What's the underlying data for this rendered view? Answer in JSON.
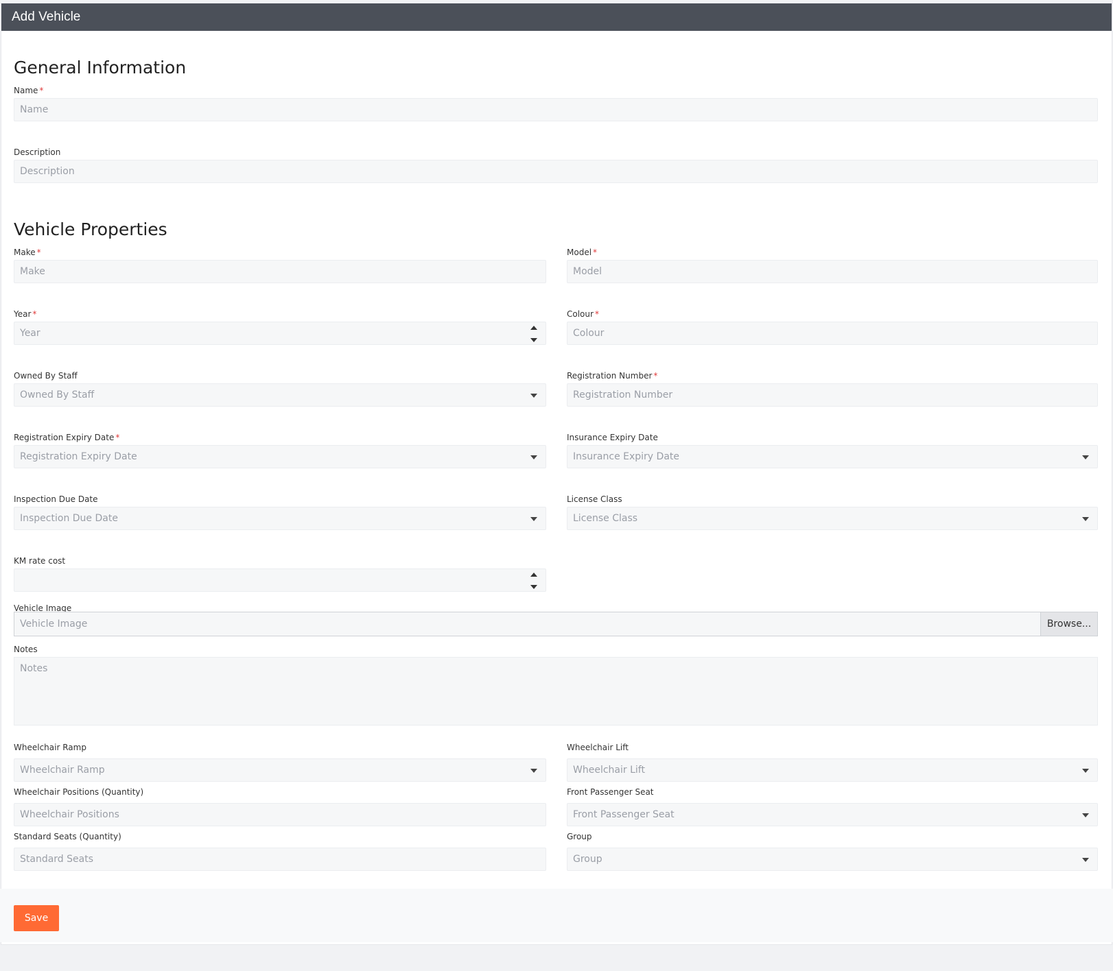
{
  "header": {
    "title": "Add Vehicle"
  },
  "general": {
    "title": "General Information",
    "name": {
      "label": "Name",
      "required": "*",
      "placeholder": "Name"
    },
    "description": {
      "label": "Description",
      "placeholder": "Description"
    }
  },
  "properties": {
    "title": "Vehicle Properties",
    "make": {
      "label": "Make",
      "required": "*",
      "placeholder": "Make"
    },
    "model": {
      "label": "Model",
      "required": "*",
      "placeholder": "Model"
    },
    "year": {
      "label": "Year",
      "required": "*",
      "placeholder": "Year"
    },
    "colour": {
      "label": "Colour",
      "required": "*",
      "placeholder": "Colour"
    },
    "owned_by_staff": {
      "label": "Owned By Staff",
      "placeholder": "Owned By Staff"
    },
    "registration_number": {
      "label": "Registration Number",
      "required": "*",
      "placeholder": "Registration Number"
    },
    "registration_expiry": {
      "label": "Registration Expiry Date",
      "required": "*",
      "placeholder": "Registration Expiry Date"
    },
    "insurance_expiry": {
      "label": "Insurance Expiry Date",
      "placeholder": "Insurance Expiry Date"
    },
    "inspection_due": {
      "label": "Inspection Due Date",
      "placeholder": "Inspection Due Date"
    },
    "license_class": {
      "label": "License Class",
      "placeholder": "License Class"
    },
    "km_rate": {
      "label": "KM rate cost",
      "placeholder": ""
    },
    "vehicle_image": {
      "label": "Vehicle Image",
      "placeholder": "Vehicle Image",
      "browse_label": "Browse..."
    },
    "notes": {
      "label": "Notes",
      "placeholder": "Notes"
    },
    "wheelchair_ramp": {
      "label": "Wheelchair Ramp",
      "placeholder": "Wheelchair Ramp"
    },
    "wheelchair_lift": {
      "label": "Wheelchair Lift",
      "placeholder": "Wheelchair Lift"
    },
    "wheelchair_positions": {
      "label": "Wheelchair Positions (Quantity)",
      "placeholder": "Wheelchair Positions"
    },
    "front_passenger_seat": {
      "label": "Front Passenger Seat",
      "placeholder": "Front Passenger Seat"
    },
    "standard_seats": {
      "label": "Standard Seats (Quantity)",
      "placeholder": "Standard Seats"
    },
    "group": {
      "label": "Group",
      "placeholder": "Group"
    }
  },
  "footer": {
    "save_label": "Save"
  },
  "colors": {
    "header_bg": "#4b5059",
    "accent": "#ff6a34",
    "required": "#e03b3b"
  }
}
